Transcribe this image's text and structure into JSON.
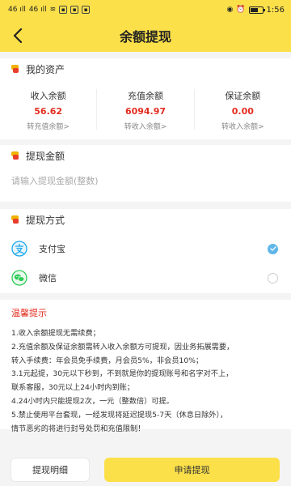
{
  "status_bar": {
    "carrier_left": "46 ıll",
    "carrier_right": "46 ıll",
    "time": "1:56"
  },
  "header": {
    "title": "余额提现"
  },
  "assets": {
    "section_title": "我的资产",
    "items": [
      {
        "label": "收入余额",
        "value": "56.62",
        "link": "转充值余额>"
      },
      {
        "label": "充值余额",
        "value": "6094.97",
        "link": "转收入余额>"
      },
      {
        "label": "保证余额",
        "value": "0.00",
        "link": "转收入余额>"
      }
    ]
  },
  "amount": {
    "section_title": "提现金额",
    "placeholder": "请输入提现金额(整数)",
    "value": ""
  },
  "method": {
    "section_title": "提现方式",
    "options": [
      {
        "label": "支付宝",
        "selected": true,
        "icon": "alipay-icon",
        "color": "#1aa7ec"
      },
      {
        "label": "微信",
        "selected": false,
        "icon": "wechat-icon",
        "color": "#2ecc56"
      }
    ]
  },
  "notice": {
    "title": "温馨提示",
    "items": [
      "1.收入余额提现无需续费；",
      "2.充值余额及保证余额需转入收入余额方可提现，因业务拓展需要，",
      "转入手续费：年会员免手续费，月会员5%，非会员10%；",
      "3.1元起提，30元以下秒到，不到就是你的提现账号和名字对不上，",
      "联系客服，30元以上24小时内到账；",
      "4.24小时内只能提现2次，一元（整数倍）可提。",
      "5.禁止使用平台套现，一经发现将延迟提现5-7天（休息日除外），",
      "情节恶劣的将进行封号处罚和充值限制！"
    ]
  },
  "footer": {
    "detail_label": "提现明细",
    "apply_label": "申请提现"
  },
  "colors": {
    "accent": "#fbe04a",
    "value_red": "#e22d20",
    "radio_blue": "#5fb6e9"
  }
}
